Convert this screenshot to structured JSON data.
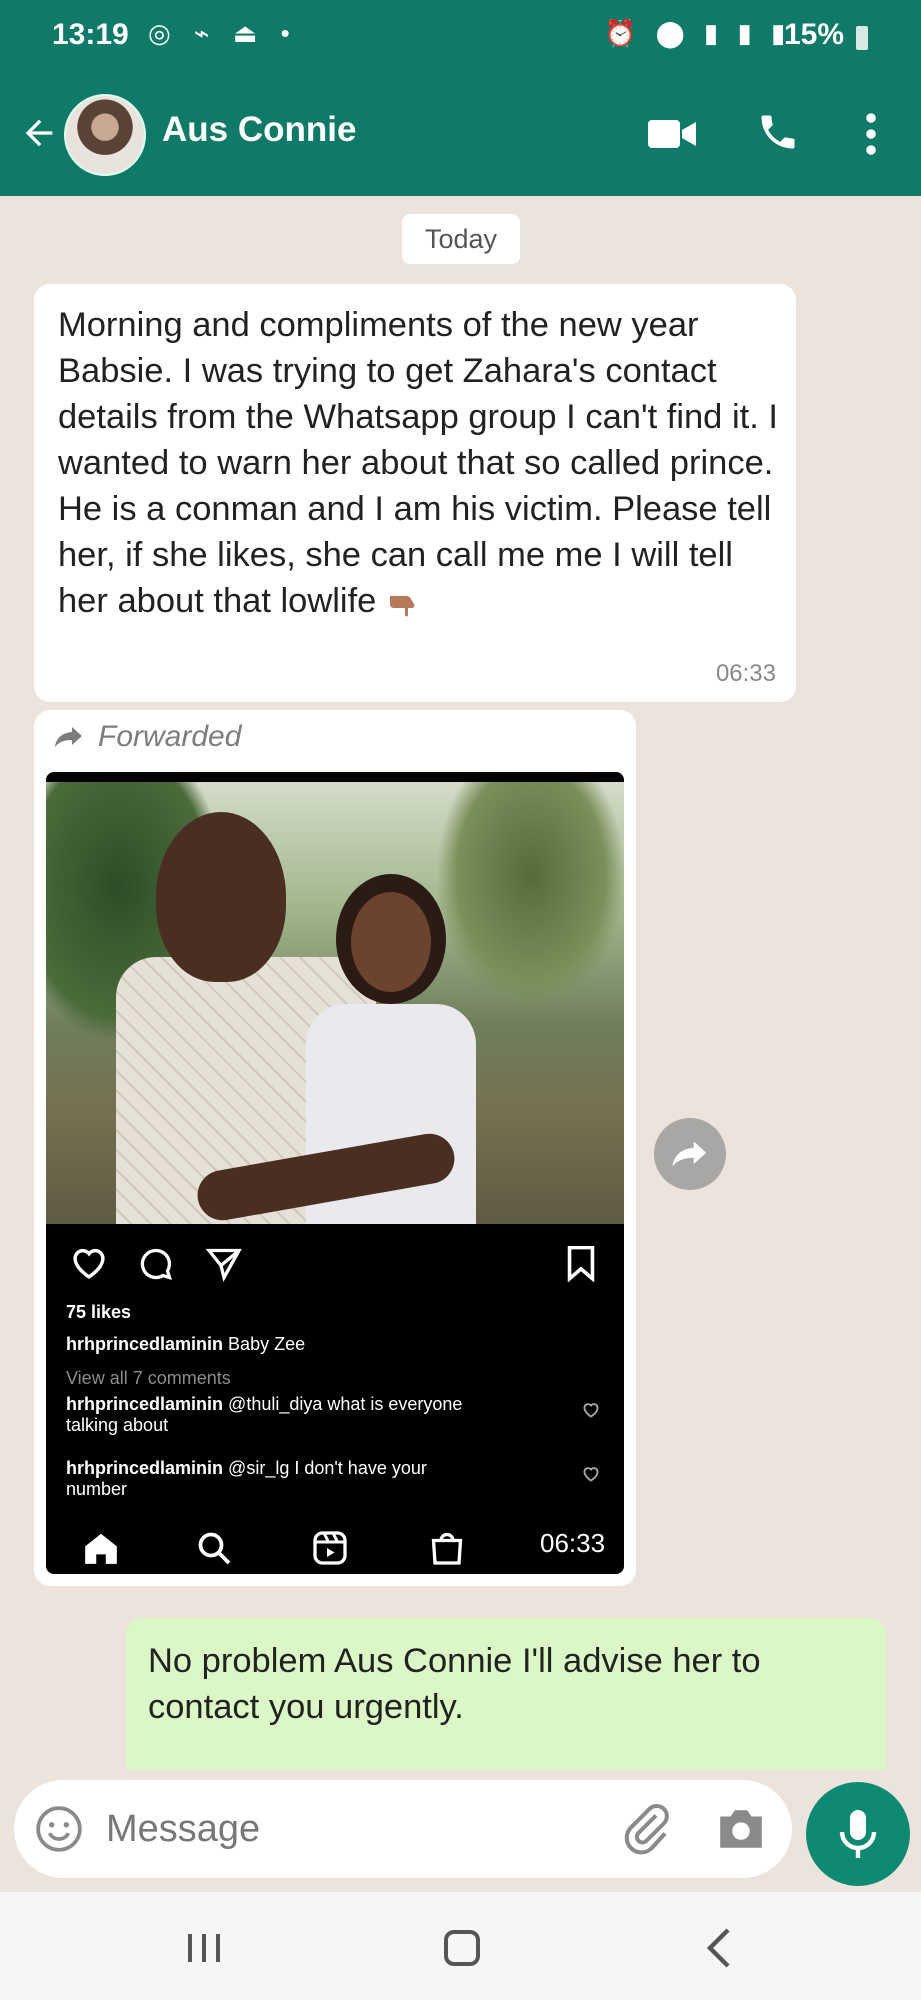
{
  "status_bar": {
    "time": "13:19",
    "battery": "15%"
  },
  "header": {
    "contact_name": "Aus Connie"
  },
  "chat": {
    "date_chip": "Today",
    "messages": [
      {
        "direction": "incoming",
        "text": "Morning and compliments of the new year Babsie. I was trying to get Zahara's contact details from the Whatsapp group I can't find it. I wanted to warn her about that so called prince. He is a conman and I am his victim. Please tell her, if she likes, she can call me me I will tell her about that lowlife",
        "emoji": "pointing-down-hand",
        "time": "06:33"
      },
      {
        "direction": "incoming",
        "forwarded_label": "Forwarded",
        "time": "06:33",
        "instagram": {
          "likes": "75 likes",
          "caption_user": "hrhprincedlaminin",
          "caption_text": "Baby Zee",
          "view_comments": "View all 7 comments",
          "comments": [
            {
              "user": "hrhprincedlaminin",
              "line1": "@thuli_diya what is everyone",
              "line2": "talking about"
            },
            {
              "user": "hrhprincedlaminin",
              "line1": "@sir_lg I don't have your",
              "line2": "number"
            }
          ]
        }
      },
      {
        "direction": "outgoing",
        "text": "No problem Aus Connie I'll advise her to contact you urgently."
      }
    ]
  },
  "composer": {
    "placeholder": "Message"
  },
  "colors": {
    "header": "#0f7a68",
    "chat_bg": "#ebe3dc",
    "outgoing_bubble": "#dcf7c6",
    "mic_button": "#0f8a72"
  }
}
